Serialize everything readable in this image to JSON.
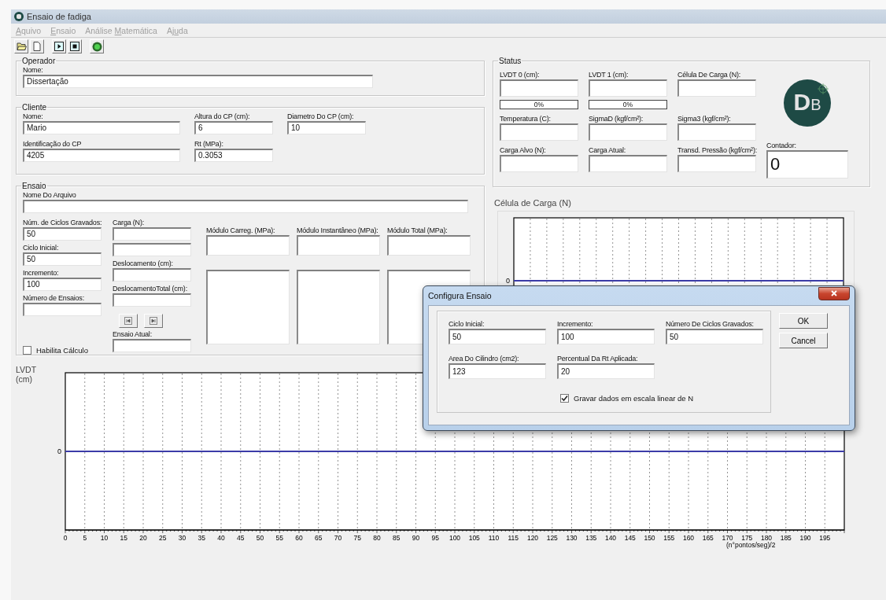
{
  "window": {
    "title": "Ensaio de fadiga"
  },
  "menu": [
    {
      "key": "A",
      "post": "quivo",
      "disabled": true
    },
    {
      "key": "E",
      "post": "nsaio",
      "disabled": true
    },
    {
      "pre": "Análise ",
      "key": "M",
      "post": "atemática",
      "disabled": true
    },
    {
      "pre": "Aj",
      "key": "u",
      "post": "da",
      "disabled": true
    }
  ],
  "operador": {
    "legend": "Operador",
    "fields": [
      {
        "label": "Nome:",
        "value": "Dissertação"
      }
    ]
  },
  "cliente": {
    "legend": "Cliente",
    "rows": [
      [
        {
          "label": "Nome:",
          "value": "Mario"
        },
        {
          "label": "Altura do CP (cm):",
          "value": "6"
        },
        {
          "label": "Diametro Do CP (cm):",
          "value": "10"
        }
      ],
      [
        {
          "label": "Identificação do CP",
          "value": "4205"
        },
        {
          "label": "Rt (MPa):",
          "value": "0.3053"
        }
      ]
    ]
  },
  "ensaio": {
    "legend": "Ensaio",
    "file": {
      "label": "Nome Do Arquivo"
    },
    "column_1": [
      {
        "label": "Núm. de Ciclos Gravados:",
        "value": "50"
      },
      {
        "label": "Ciclo Inicial:",
        "value": "50"
      },
      {
        "label": "Incremento:",
        "value": "100"
      },
      {
        "label": "Número de Ensaios:"
      }
    ],
    "checkbox": {
      "label": "Habilita Cálculo",
      "checked": false
    },
    "column_2": [
      {
        "label": "Carga (N):",
        "extra_field": true
      },
      {
        "label": "Deslocamento (cm):"
      },
      {
        "label": "DeslocamentoTotal (cm):"
      }
    ],
    "current": {
      "label": "Ensaio Atual:"
    },
    "modules": [
      {
        "label": "Módulo Carreg. (MPa):"
      },
      {
        "label": "Módulo Instantâneo (MPa):"
      },
      {
        "label": "Módulo Total (MPa):"
      }
    ]
  },
  "status": {
    "legend": "Status",
    "items": [
      {
        "label": "LVDT 0 (cm):",
        "progress": {
          "reading": "0%",
          "level": 0
        }
      },
      {
        "label": "LVDT 1 (cm):",
        "progress": {
          "reading": "0%",
          "level": 0
        }
      },
      {
        "label": "Célula De Carga (N):"
      },
      {
        "label": "Temperatura (C):"
      },
      {
        "label": "SigmaD (kgf/cm²):"
      },
      {
        "label": "Sigma3 (kgf/cm²):"
      },
      {
        "label": "Carga Alvo (N):"
      },
      {
        "label": "Carga Atual:"
      },
      {
        "label": "Transd. Pressão (kgf/cm²):"
      }
    ],
    "logo": {
      "main": "D",
      "sub": "B"
    },
    "counter": {
      "label": "Contador:",
      "value": "0"
    }
  },
  "load_chart": {
    "title": "Célula de Carga (N)",
    "y_axis_label": "0"
  },
  "lvdt_chart": {
    "y_title": "LVDT (cm)",
    "x_title": "(n°pontos/seg)/2",
    "y_axis_label": "0",
    "x_axis_labels": [
      "0",
      "5",
      "10",
      "15",
      "20",
      "25",
      "30",
      "35",
      "40",
      "45",
      "50",
      "55",
      "60",
      "65",
      "70",
      "75",
      "80",
      "85",
      "90",
      "95",
      "100",
      "105",
      "110",
      "115",
      "120",
      "125",
      "130",
      "135",
      "140",
      "145",
      "150",
      "155",
      "160",
      "165",
      "170",
      "175",
      "180",
      "185",
      "190",
      "195"
    ]
  },
  "dialog": {
    "title": "Configura Ensaio",
    "rows": [
      [
        {
          "label": "Ciclo Inicial:",
          "value": "50"
        },
        {
          "label": "Incremento:",
          "value": "100"
        },
        {
          "label": "Número De Ciclos Gravados:",
          "value": "50"
        }
      ],
      [
        {
          "label": "Area Do Cilindro (cm2):",
          "value": "123"
        },
        {
          "label": "Percentual Da Rt Aplicada:",
          "value": "20"
        }
      ]
    ],
    "checkbox": {
      "label": "Gravar dados em escala linear de N",
      "checked": true
    },
    "buttons": [
      "OK",
      "Cancel"
    ]
  }
}
